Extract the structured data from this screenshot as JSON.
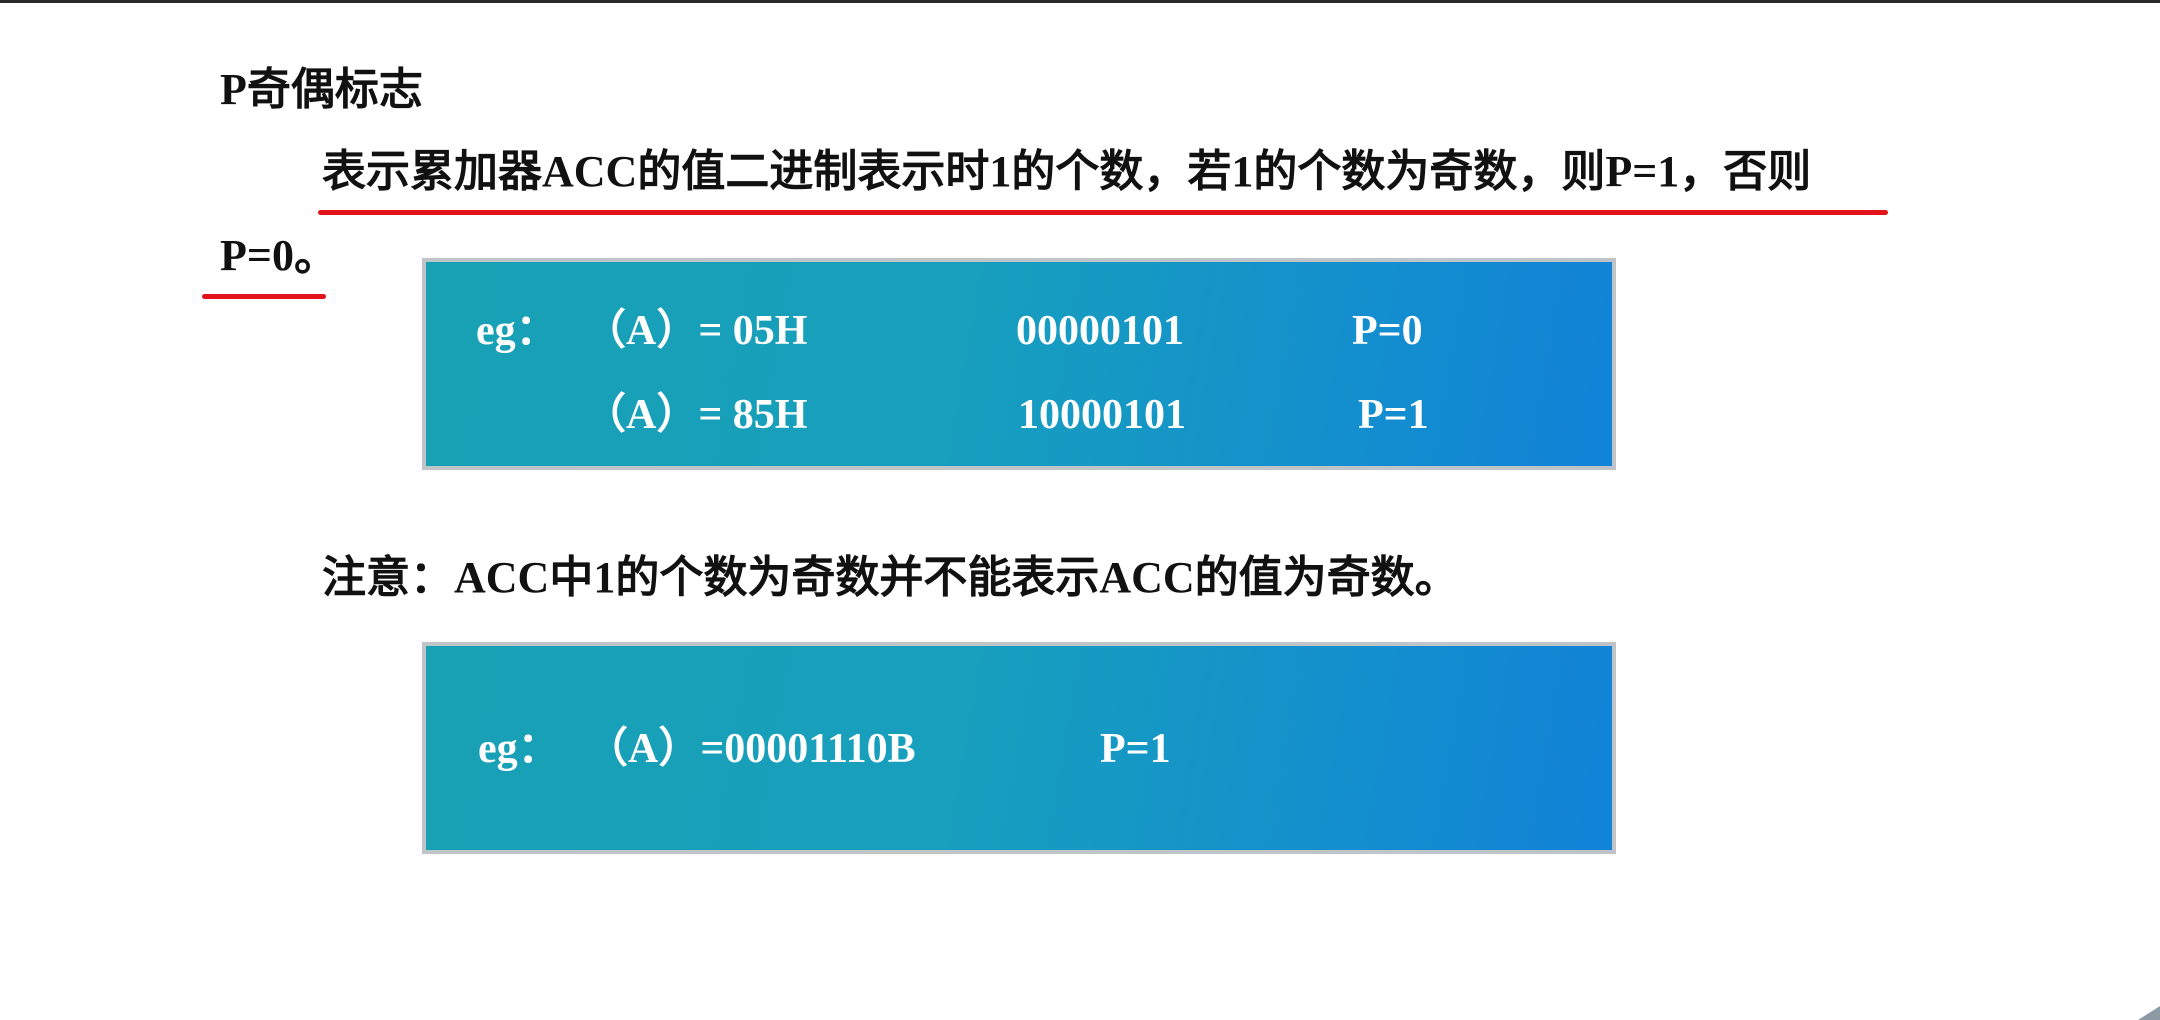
{
  "heading": "P奇偶标志",
  "definition": {
    "line1": "表示累加器ACC的值二进制表示时1的个数，若1的个数为奇数，则P=1，否则",
    "line2": "P=0。"
  },
  "example1": {
    "row1": {
      "label": "eg：",
      "expr": "（A）= 05H",
      "binary": "00000101",
      "parity": "P=0"
    },
    "row2": {
      "expr": "（A）= 85H",
      "binary": "10000101",
      "parity": "P=1"
    }
  },
  "note": "注意：ACC中1的个数为奇数并不能表示ACC的值为奇数。",
  "example2": {
    "label": "eg：",
    "expr": "（A）=00001110B",
    "parity": "P=1"
  },
  "colors": {
    "underline": "#e3131b",
    "box_gradient_start": "#18a0b4",
    "box_gradient_end": "#1183d8"
  }
}
